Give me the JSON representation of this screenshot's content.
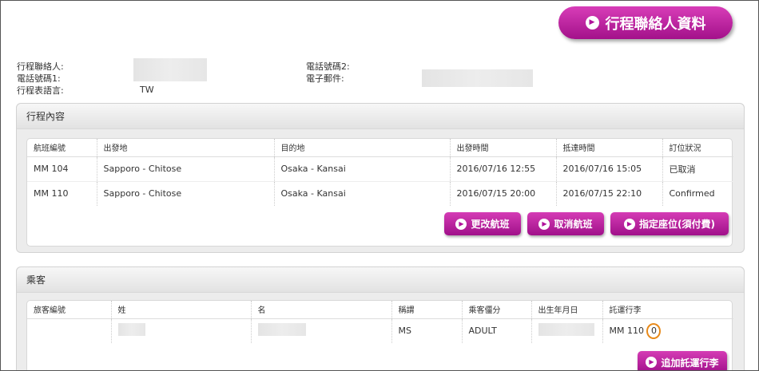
{
  "header": {
    "contact_button_label": "行程聯絡人資料"
  },
  "contact": {
    "contact_person_label": "行程聯絡人:",
    "phone1_label": "電話號碼1:",
    "language_label": "行程表語言:",
    "language_value": "TW",
    "phone2_label": "電話號碼2:",
    "email_label": "電子郵件:"
  },
  "itinerary": {
    "title": "行程內容",
    "columns": [
      "航班編號",
      "出發地",
      "目的地",
      "出發時間",
      "抵達時間",
      "訂位狀況"
    ],
    "rows": [
      [
        "MM 104",
        "Sapporo - Chitose",
        "Osaka - Kansai",
        "2016/07/16  12:55",
        "2016/07/16  15:05",
        "已取消"
      ],
      [
        "MM 110",
        "Sapporo - Chitose",
        "Osaka - Kansai",
        "2016/07/15  20:00",
        "2016/07/15  22:10",
        "Confirmed"
      ]
    ],
    "buttons": {
      "change_flight": "更改航班",
      "cancel_flight": "取消航班",
      "select_seat": "指定座位(須付費)"
    }
  },
  "passengers": {
    "title": "乘客",
    "columns": [
      "旅客編號",
      "姓",
      "名",
      "稱謂",
      "乘客僵分",
      "出生年月日",
      "託運行李"
    ],
    "row": {
      "title": "MS",
      "type": "ADULT",
      "baggage_flight": "MM 110",
      "baggage_count": "0"
    },
    "add_baggage_button": "追加託運行李"
  }
}
